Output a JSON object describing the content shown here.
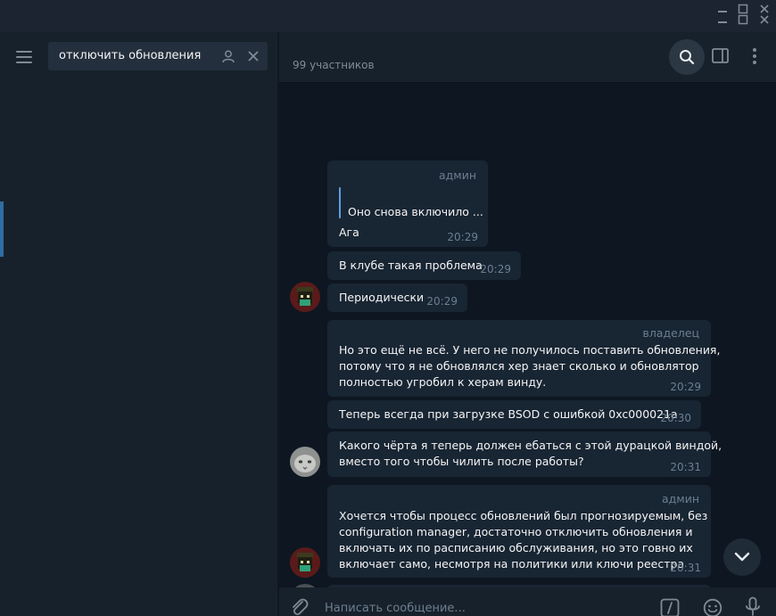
{
  "search": {
    "query": "отключить обновления"
  },
  "header": {
    "members": "99 участников"
  },
  "messages": [
    {
      "author": "админ",
      "quote": "Оно снова включило ...",
      "text": "Ага",
      "time": "20:29"
    },
    {
      "text": "В клубе такая проблема",
      "time": "20:29"
    },
    {
      "text": "Периодически",
      "time": "20:29"
    },
    {
      "author": "владелец",
      "lines": [
        "Но это ещё не всё. У него не получилось поставить обновления,",
        "потому что я не обновлялся хер знает сколько и обновлятор",
        "полностью угробил к херам винду."
      ],
      "time": "20:29"
    },
    {
      "text": "Теперь всегда при загрузке BSOD с ошибкой 0xc000021a",
      "time": "20:30"
    },
    {
      "lines": [
        "Какого чёрта я теперь должен ебаться с этой дурацкой виндой,",
        "вместо того чтобы чилить после работы?"
      ],
      "time": "20:31"
    },
    {
      "author": "админ",
      "lines": [
        "Хочется чтобы процесс обновлений был прогнозируемым, без",
        "configuration manager,  достаточно отключить обновления и",
        "включать их по расписанию обслуживания,  но это говно их",
        "включает само, несмотря на политики или ключи реестра"
      ],
      "time": "20:31"
    }
  ],
  "composer": {
    "placeholder": "Написать сообщение..."
  },
  "icons": {
    "menu": "hamburger-icon",
    "search": "search-icon",
    "person": "person-icon",
    "close": "close-icon",
    "panel": "sidebar-panel-icon",
    "more": "more-vertical-icon",
    "attach": "paperclip-icon",
    "commands": "slash-command-icon",
    "emoji": "emoji-icon",
    "mic": "microphone-icon",
    "scroll": "chevron-down-icon"
  },
  "colors": {
    "background": "#0e1621",
    "panel": "#17212b",
    "bubble": "#182533",
    "accent": "#5ea0e0",
    "muted": "#6d7f8f"
  }
}
